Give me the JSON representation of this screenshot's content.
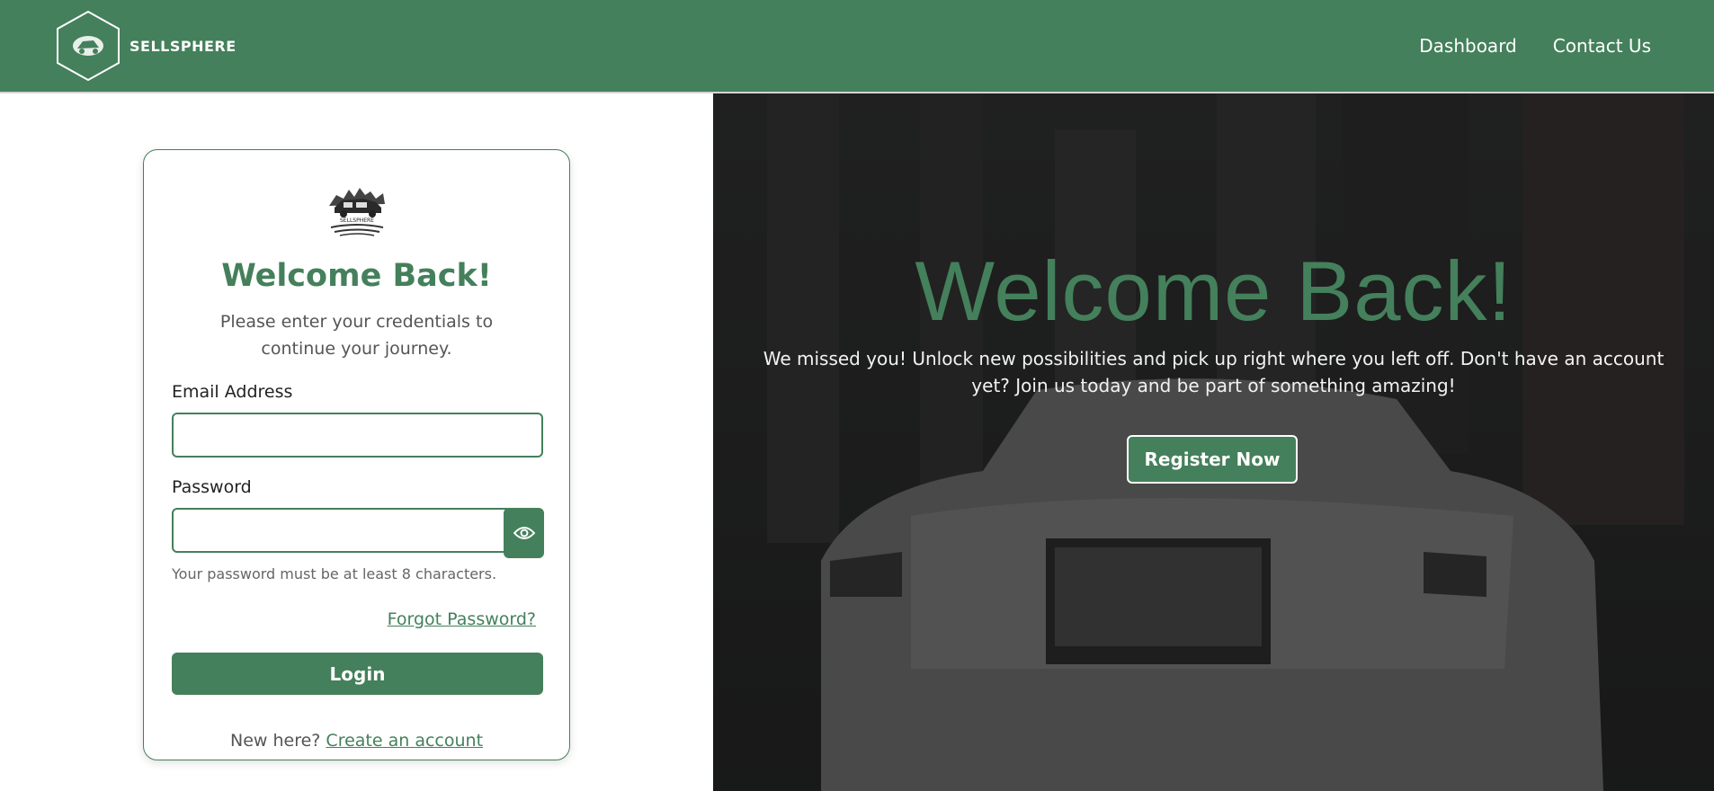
{
  "brand": {
    "name": "SELLSPHERE",
    "logo_caption": "SELLSPHERE"
  },
  "nav": {
    "links": [
      {
        "label": "Dashboard"
      },
      {
        "label": "Contact Us"
      }
    ]
  },
  "login_card": {
    "title": "Welcome Back!",
    "subtitle": "Please enter your credentials to continue your journey.",
    "email_label": "Email Address",
    "email_value": "",
    "password_label": "Password",
    "password_value": "",
    "password_hint": "Your password must be at least 8 characters.",
    "forgot_link": "Forgot Password?",
    "login_button": "Login",
    "signup_prompt": "New here?",
    "signup_link": "Create an account"
  },
  "hero": {
    "title": "Welcome Back!",
    "text": "We missed you! Unlock new possibilities and pick up right where you left off. Don't have an account yet? Join us today and be part of something amazing!",
    "register_button": "Register Now"
  },
  "colors": {
    "primary": "#44805b",
    "hero_overlay": "#2b2c2c",
    "white": "#ffffff"
  },
  "icons": {
    "password_toggle": "eye-icon",
    "brand": "car-logo-icon"
  }
}
